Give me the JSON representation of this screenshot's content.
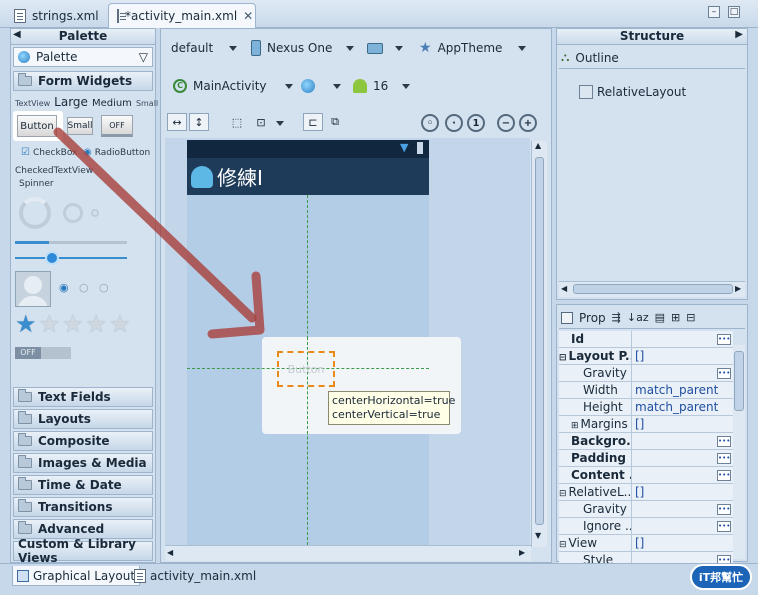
{
  "tabs": [
    {
      "label": "strings.xml"
    },
    {
      "label": "*activity_main.xml"
    }
  ],
  "palette": {
    "title": "Palette",
    "selector": "Palette",
    "open_category": "Form Widgets",
    "widgets_row1": {
      "textview": "TextView",
      "large": "Large",
      "medium": "Medium",
      "small": "Small"
    },
    "button_label": "Button",
    "small_button_label": "Small",
    "toggle_label": "OFF",
    "checkbox_label": "CheckBox",
    "radio_label": "RadioButton",
    "checked_text": "CheckedTextView",
    "spinner_label": "Spinner",
    "switch_label": "OFF",
    "rating_stars_on": 1,
    "rating_stars_total": 5,
    "categories": [
      "Text Fields",
      "Layouts",
      "Composite",
      "Images & Media",
      "Time & Date",
      "Transitions",
      "Advanced",
      "Custom & Library Views"
    ]
  },
  "toolbar": {
    "config": "default",
    "device": "Nexus One",
    "theme": "AppTheme",
    "activity": "MainActivity",
    "api": "16"
  },
  "device_screen": {
    "app_title": "修練I",
    "drag_button_text": "Button",
    "tooltip_line1": "centerHorizontal=true",
    "tooltip_line2": "centerVertical=true"
  },
  "structure": {
    "title": "Structure",
    "outline_label": "Outline",
    "tree_item": "RelativeLayout"
  },
  "properties": {
    "title": "Prop",
    "rows": [
      {
        "name": "Id",
        "value": "",
        "bold": true,
        "dots": true
      },
      {
        "name": "Layout P...",
        "value": "[]",
        "bold": true,
        "expander": "−"
      },
      {
        "name": "Gravity",
        "value": "",
        "indent": true,
        "dots": true
      },
      {
        "name": "Width",
        "value": "match_parent",
        "indent": true
      },
      {
        "name": "Height",
        "value": "match_parent",
        "indent": true
      },
      {
        "name": "Margins",
        "value": "[]",
        "indent": true,
        "expander": "+"
      },
      {
        "name": "Backgro...",
        "value": "",
        "bold": true,
        "dots": true
      },
      {
        "name": "Padding ...",
        "value": "",
        "bold": true,
        "dots": true
      },
      {
        "name": "Content ...",
        "value": "",
        "bold": true,
        "dots": true
      },
      {
        "name": "RelativeL...",
        "value": "[]",
        "expander": "−"
      },
      {
        "name": "Gravity",
        "value": "",
        "indent": true,
        "dots": true
      },
      {
        "name": "Ignore ...",
        "value": "",
        "indent": true,
        "dots": true
      },
      {
        "name": "View",
        "value": "[]",
        "expander": "−"
      },
      {
        "name": "Style",
        "value": "",
        "indent": true,
        "dots": true
      }
    ]
  },
  "bottom_tabs": [
    {
      "label": "Graphical Layout"
    },
    {
      "label": "activity_main.xml"
    }
  ],
  "watermark": "iT邦幫忙"
}
